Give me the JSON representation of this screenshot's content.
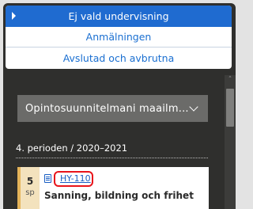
{
  "teaching_options": [
    {
      "label": "Ej vald undervisning",
      "selected": true
    },
    {
      "label": "Anmälningen",
      "selected": false
    },
    {
      "label": "Avslutad och avbrutna",
      "selected": false
    }
  ],
  "study_plan_select": {
    "value": "Opintosuunnitelmani maailm..."
  },
  "period": {
    "label": "4. perioden / 2020–2021"
  },
  "course": {
    "credits": "5",
    "credits_unit": "sp",
    "code": "HY-110",
    "name": "Sanning, bildning och frihet",
    "accent_color": "#e5b45a"
  },
  "colors": {
    "selected_option_bg": "#1f6bd0",
    "link": "#1a6fd1",
    "highlight_outline": "#e8141b",
    "panel_bg": "#2f2f2d"
  }
}
